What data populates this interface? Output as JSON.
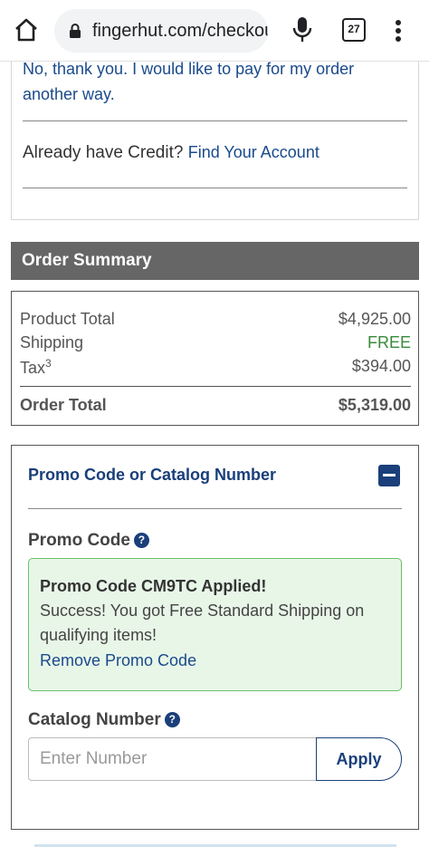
{
  "browser": {
    "url": "fingerhut.com/checkout",
    "tab_count": "27"
  },
  "payment": {
    "other_way_text": "No, thank you. I would like to pay for my order another way.",
    "credit_question": "Already have Credit?",
    "find_account_link": "Find Your Account"
  },
  "order_summary": {
    "header": "Order Summary",
    "product_total_label": "Product Total",
    "product_total_value": "$4,925.00",
    "shipping_label": "Shipping",
    "shipping_value": "FREE",
    "tax_label": "Tax",
    "tax_footnote": "3",
    "tax_value": "$394.00",
    "order_total_label": "Order Total",
    "order_total_value": "$5,319.00"
  },
  "promo": {
    "section_title": "Promo Code or Catalog Number",
    "promo_code_label": "Promo Code",
    "applied_title": "Promo Code CM9TC Applied!",
    "applied_message": "Success! You got Free Standard Shipping on qualifying items!",
    "remove_link": "Remove Promo Code",
    "catalog_label": "Catalog Number",
    "catalog_placeholder": "Enter Number",
    "apply_label": "Apply",
    "help_glyph": "?"
  },
  "colors": {
    "link_blue": "#1a4a8c",
    "header_gray": "#666666",
    "success_green": "#3a8a3a"
  }
}
